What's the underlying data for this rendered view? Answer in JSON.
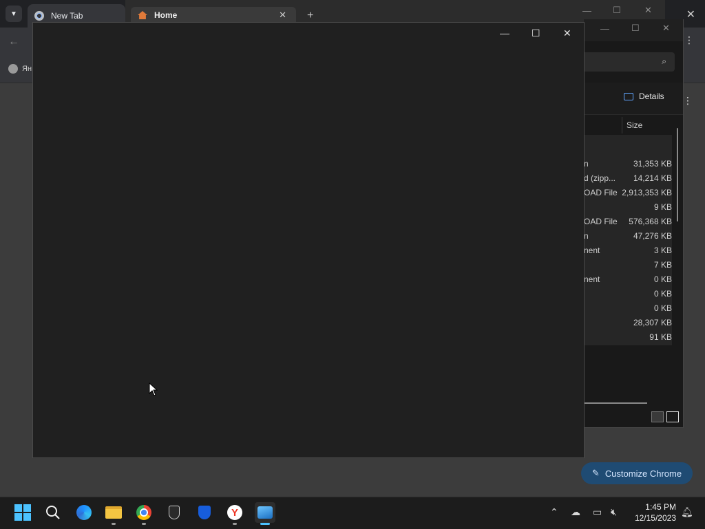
{
  "chrome": {
    "tab_label": "New Tab",
    "bookmark_label": "Ян",
    "customize_label": "Customize Chrome"
  },
  "home_window": {
    "tab_label": "Home"
  },
  "explorer": {
    "details_label": "Details",
    "size_header": "Size",
    "rows": [
      {
        "type": "n",
        "size": "31,353 KB"
      },
      {
        "type": "d (zipp...",
        "size": "14,214 KB"
      },
      {
        "type": "OAD File",
        "size": "2,913,353 KB"
      },
      {
        "type": "",
        "size": "9 KB"
      },
      {
        "type": "OAD File",
        "size": "576,368 KB"
      },
      {
        "type": "n",
        "size": "47,276 KB"
      },
      {
        "type": "nent",
        "size": "3 KB"
      },
      {
        "type": "",
        "size": "7 KB"
      },
      {
        "type": "nent",
        "size": "0 KB"
      },
      {
        "type": "",
        "size": "0 KB"
      },
      {
        "type": "",
        "size": "0 KB"
      },
      {
        "type": "",
        "size": "28,307 KB"
      },
      {
        "type": "",
        "size": "91 KB"
      }
    ]
  },
  "app_window": {
    "minimize_glyph": "—",
    "maximize_glyph": "☐",
    "close_glyph": "✕"
  },
  "taskbar": {
    "time": "1:45 PM",
    "date": "12/15/2023",
    "apps": [
      "start-icon",
      "search-icon",
      "edge-beta-icon",
      "file-explorer-icon",
      "chrome-icon",
      "security-app-icon",
      "bitwarden-icon",
      "yandex-browser-icon",
      "photos-icon"
    ],
    "accent": "#4cc2ff"
  }
}
